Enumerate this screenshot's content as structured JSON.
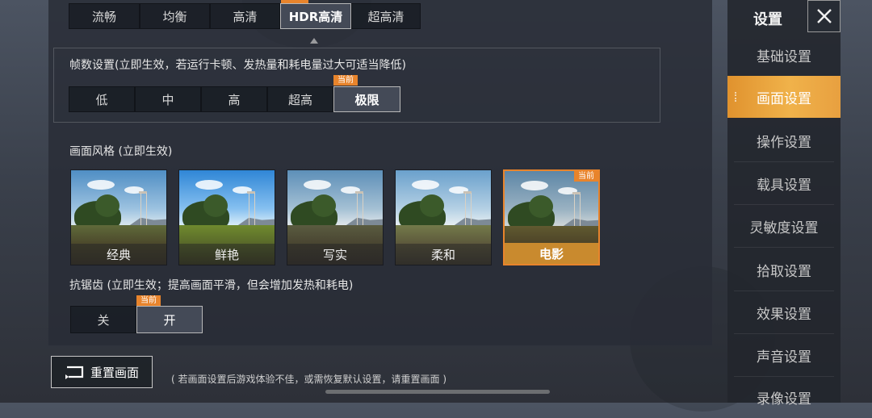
{
  "quality": {
    "options": [
      "流畅",
      "均衡",
      "高清",
      "HDR高清",
      "超高清"
    ],
    "selected": "HDR高清"
  },
  "fps": {
    "title": "帧数设置(立即生效，若运行卡顿、发热量和耗电量过大可适当降低)",
    "options": [
      "低",
      "中",
      "高",
      "超高",
      "极限"
    ],
    "selected": "极限",
    "current_tag": "当前"
  },
  "style": {
    "title": "画面风格 (立即生效)",
    "options": [
      "经典",
      "鲜艳",
      "写实",
      "柔和",
      "电影"
    ],
    "selected": "电影",
    "current_tag": "当前"
  },
  "antialias": {
    "title": "抗锯齿 (立即生效；提高画面平滑，但会增加发热和耗电)",
    "options": [
      "关",
      "开"
    ],
    "selected": "开",
    "current_tag": "当前"
  },
  "footer": {
    "reset_label": "重置画面",
    "hint": "( 若画面设置后游戏体验不佳，或需恢复默认设置，请重置画面 )"
  },
  "sidebar": {
    "title": "设置",
    "items": [
      "基础设置",
      "画面设置",
      "操作设置",
      "载具设置",
      "灵敏度设置",
      "拾取设置",
      "效果设置",
      "声音设置",
      "录像设置"
    ],
    "active": "画面设置"
  },
  "colors": {
    "accent": "#e8842c",
    "active_tab": "#f0b24a"
  }
}
